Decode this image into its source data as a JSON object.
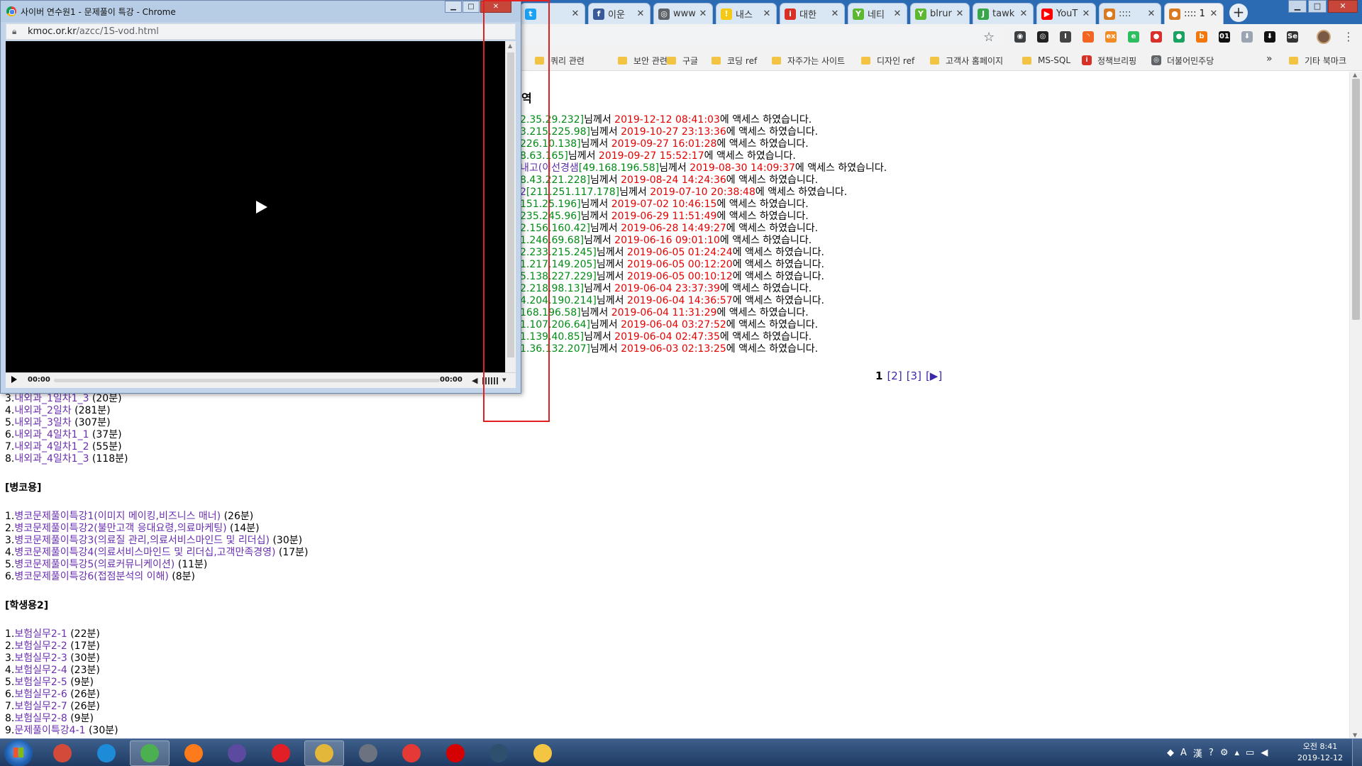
{
  "browser": {
    "tabs": [
      {
        "label": "",
        "color": "#1da1f2",
        "glyph": "t"
      },
      {
        "label": "이운",
        "color": "#3b5998",
        "glyph": "f"
      },
      {
        "label": "www",
        "color": "#5f6368",
        "glyph": "◎"
      },
      {
        "label": "내스",
        "color": "#f6c915",
        "glyph": "!"
      },
      {
        "label": "대한",
        "color": "#d93025",
        "glyph": "i"
      },
      {
        "label": "네티",
        "color": "#5cb82f",
        "glyph": "Y"
      },
      {
        "label": "blrur",
        "color": "#5cb82f",
        "glyph": "Y"
      },
      {
        "label": "tawk",
        "color": "#3aa64b",
        "glyph": "J"
      },
      {
        "label": "YouT",
        "color": "#ff0000",
        "glyph": "▶"
      },
      {
        "label": "::::",
        "color": "#d87a22",
        "glyph": "●"
      },
      {
        "label": ":::: 1",
        "color": "#d87a22",
        "glyph": "●",
        "active": true
      }
    ],
    "tab_close": "✕",
    "new_tab": "+",
    "extensions": [
      {
        "name": "ext-1",
        "color": "#3c4043",
        "glyph": "◉"
      },
      {
        "name": "ext-2",
        "color": "#222222",
        "glyph": "◎"
      },
      {
        "name": "ext-3",
        "color": "#444444",
        "glyph": "I"
      },
      {
        "name": "rss-icon",
        "color": "#f26522",
        "glyph": "◝"
      },
      {
        "name": "ext-5",
        "color": "#f38b24",
        "glyph": "ex"
      },
      {
        "name": "evernote-icon",
        "color": "#2dbe60",
        "glyph": "e"
      },
      {
        "name": "ext-7",
        "color": "#d9302c",
        "glyph": "●"
      },
      {
        "name": "ext-8",
        "color": "#1aa260",
        "glyph": "●"
      },
      {
        "name": "ext-9",
        "color": "#f4770b",
        "glyph": "b"
      },
      {
        "name": "ext-10",
        "color": "#111111",
        "glyph": "01"
      },
      {
        "name": "download-arrow-icon",
        "color": "#9aa4b2",
        "glyph": "⬇"
      },
      {
        "name": "download-icon",
        "color": "#111111",
        "glyph": "⬇"
      },
      {
        "name": "ext-13",
        "color": "#333333",
        "glyph": "Se"
      }
    ],
    "bookmarks": [
      {
        "label": "쿼리 관련",
        "type": "folder"
      },
      {
        "label": "보안 관련",
        "type": "folder"
      },
      {
        "label": "구글",
        "type": "folder"
      },
      {
        "label": "코딩 ref",
        "type": "folder"
      },
      {
        "label": "자주가는 사이트",
        "type": "folder"
      },
      {
        "label": "디자인 ref",
        "type": "folder"
      },
      {
        "label": "고객사 홈페이지",
        "type": "folder"
      },
      {
        "label": "MS-SQL",
        "type": "folder"
      },
      {
        "label": "정책브리핑",
        "type": "site",
        "color": "#d93025",
        "glyph": "i"
      },
      {
        "label": "더불어민주당",
        "type": "site",
        "color": "#5f6368",
        "glyph": "◎"
      }
    ],
    "bookmarks_more": "»",
    "other_bookmarks": "기타 북마크"
  },
  "popup": {
    "title": "사이버 연수원1 - 문제풀이 특강 - Chrome",
    "url_host": "kmoc.or.kr",
    "url_path": "/azcc/1S-vod.html",
    "player": {
      "current_time": "00:00",
      "duration": "00:00"
    }
  },
  "page": {
    "history_title": "역",
    "history": [
      {
        "pre": "",
        "ip": "2.35.29.232]",
        "mid": "님께서 ",
        "ts": "2019-12-12 08:41:03",
        "sfx": "에 액세스 하였습니다."
      },
      {
        "pre": "",
        "ip": "3.215.225.98]",
        "mid": "님께서 ",
        "ts": "2019-10-27 23:13:36",
        "sfx": "에 액세스 하였습니다."
      },
      {
        "pre": "",
        "ip": "226.10.138]",
        "mid": "님께서 ",
        "ts": "2019-09-27 16:01:28",
        "sfx": "에 액세스 하였습니다."
      },
      {
        "pre": "",
        "ip": "8.63.165]",
        "mid": "님께서 ",
        "ts": "2019-09-27 15:52:17",
        "sfx": "에 액세스 하였습니다."
      },
      {
        "pre": "내고(이선경샘",
        "ip": "[49.168.196.58]",
        "mid": "님께서 ",
        "ts": "2019-08-30 14:09:37",
        "sfx": "에 액세스 하였습니다."
      },
      {
        "pre": "",
        "ip": "8.43.221.228]",
        "mid": "님께서 ",
        "ts": "2019-08-24 14:24:36",
        "sfx": "에 액세스 하였습니다."
      },
      {
        "pre": "2",
        "ip": "[211.251.117.178]",
        "mid": "님께서 ",
        "ts": "2019-07-10 20:38:48",
        "sfx": "에 액세스 하였습니다."
      },
      {
        "pre": "",
        "ip": "151.25.196]",
        "mid": "님께서 ",
        "ts": "2019-07-02 10:46:15",
        "sfx": "에 액세스 하였습니다."
      },
      {
        "pre": "",
        "ip": "235.245.96]",
        "mid": "님께서 ",
        "ts": "2019-06-29 11:51:49",
        "sfx": "에 액세스 하였습니다."
      },
      {
        "pre": "",
        "ip": "2.156.160.42]",
        "mid": "님께서 ",
        "ts": "2019-06-28 14:49:27",
        "sfx": "에 액세스 하였습니다."
      },
      {
        "pre": "",
        "ip": "1.246.69.68]",
        "mid": "님께서 ",
        "ts": "2019-06-16 09:01:10",
        "sfx": "에 액세스 하였습니다."
      },
      {
        "pre": "",
        "ip": "2.233.215.245]",
        "mid": "님께서 ",
        "ts": "2019-06-05 01:24:24",
        "sfx": "에 액세스 하였습니다."
      },
      {
        "pre": "",
        "ip": "1.217.149.205]",
        "mid": "님께서 ",
        "ts": "2019-06-05 00:12:20",
        "sfx": "에 액세스 하였습니다."
      },
      {
        "pre": "",
        "ip": "5.138.227.229]",
        "mid": "님께서 ",
        "ts": "2019-06-05 00:10:12",
        "sfx": "에 액세스 하였습니다."
      },
      {
        "pre": "",
        "ip": "2.218.98.13]",
        "mid": "님께서 ",
        "ts": "2019-06-04 23:37:39",
        "sfx": "에 액세스 하였습니다."
      },
      {
        "pre": "",
        "ip": "4.204.190.214]",
        "mid": "님께서 ",
        "ts": "2019-06-04 14:36:57",
        "sfx": "에 액세스 하였습니다."
      },
      {
        "pre": "",
        "ip": "168.196.58]",
        "mid": "님께서 ",
        "ts": "2019-06-04 11:31:29",
        "sfx": "에 액세스 하였습니다."
      },
      {
        "pre": "",
        "ip": "1.107.206.64]",
        "mid": "님께서 ",
        "ts": "2019-06-04 03:27:52",
        "sfx": "에 액세스 하였습니다."
      },
      {
        "pre": "",
        "ip": "1.139.40.85]",
        "mid": "님께서 ",
        "ts": "2019-06-04 02:47:35",
        "sfx": "에 액세스 하였습니다."
      },
      {
        "pre": "",
        "ip": "1.36.132.207]",
        "mid": "님께서 ",
        "ts": "2019-06-03 02:13:25",
        "sfx": "에 액세스 하였습니다."
      }
    ],
    "pager": {
      "current": "1",
      "pages": [
        "[2]",
        "[3]"
      ],
      "next": "[▶]"
    },
    "sections": [
      {
        "title": "",
        "items": [
          {
            "num": "3.",
            "title": "내외과_1일차1_3",
            "dur": " (20분)"
          },
          {
            "num": "4.",
            "title": "내외과_2일차",
            "dur": " (281분)"
          },
          {
            "num": "5.",
            "title": "내외과_3일차",
            "dur": " (307분)"
          },
          {
            "num": "6.",
            "title": "내외과_4일차1_1",
            "dur": " (37분)"
          },
          {
            "num": "7.",
            "title": "내외과_4일차1_2",
            "dur": " (55분)"
          },
          {
            "num": "8.",
            "title": "내외과_4일차1_3",
            "dur": " (118분)"
          }
        ]
      },
      {
        "title": "[병코용]",
        "items": [
          {
            "num": "1.",
            "title": "병코문제풀이특강1(이미지 메이킹,비즈니스 매너)",
            "dur": " (26분)"
          },
          {
            "num": "2.",
            "title": "병코문제풀이특강2(불만고객 응대요령,의료마케팅)",
            "dur": " (14분)"
          },
          {
            "num": "3.",
            "title": "병코문제풀이특강3(의료질 관리,의료서비스마인드 및 리더십)",
            "dur": " (30분)"
          },
          {
            "num": "4.",
            "title": "병코문제풀이특강4(의료서비스마인드 및 리더십,고객만족경영)",
            "dur": " (17분)"
          },
          {
            "num": "5.",
            "title": "병코문제풀이특강5(의료커뮤니케이션)",
            "dur": " (11분)"
          },
          {
            "num": "6.",
            "title": "병코문제풀이특강6(접점분석의 이해)",
            "dur": " (8분)"
          }
        ]
      },
      {
        "title": "[학생용2]",
        "items": [
          {
            "num": "1.",
            "title": "보험실무2-1",
            "dur": " (22분)"
          },
          {
            "num": "2.",
            "title": "보험실무2-2",
            "dur": " (17분)"
          },
          {
            "num": "3.",
            "title": "보험실무2-3",
            "dur": " (30분)"
          },
          {
            "num": "4.",
            "title": "보험실무2-4",
            "dur": " (23분)"
          },
          {
            "num": "5.",
            "title": "보험실무2-5",
            "dur": " (9분)"
          },
          {
            "num": "6.",
            "title": "보험실무2-6",
            "dur": " (26분)"
          },
          {
            "num": "7.",
            "title": "보험실무2-7",
            "dur": " (26분)"
          },
          {
            "num": "8.",
            "title": "보험실무2-8",
            "dur": " (9분)"
          },
          {
            "num": "9.",
            "title": "문제풀이특강4-1",
            "dur": " (30분)"
          }
        ]
      }
    ]
  },
  "taskbar": {
    "apps": [
      {
        "name": "taskbar-app-vivaldi",
        "color": "#d44a3a",
        "sel": false
      },
      {
        "name": "taskbar-app-ie",
        "color": "#1e8bd8",
        "sel": false
      },
      {
        "name": "taskbar-app-chrome",
        "color": "#4caf50",
        "sel": true
      },
      {
        "name": "taskbar-app-firefox",
        "color": "#ff7a1a",
        "sel": false
      },
      {
        "name": "taskbar-app-eclipse",
        "color": "#5b4aa0",
        "sel": false
      },
      {
        "name": "taskbar-app-opera",
        "color": "#e21f26",
        "sel": false
      },
      {
        "name": "taskbar-app-tool",
        "color": "#e3b73a",
        "sel": true
      },
      {
        "name": "taskbar-app-book",
        "color": "#6b7280",
        "sel": false
      },
      {
        "name": "taskbar-app-pokeball",
        "color": "#e53935",
        "sel": false
      },
      {
        "name": "taskbar-app-record",
        "color": "#d50000",
        "sel": false
      },
      {
        "name": "taskbar-app-tree",
        "color": "#2f4f6f",
        "sel": false
      },
      {
        "name": "taskbar-app-folder",
        "color": "#f4c542",
        "sel": false
      }
    ],
    "tray_lang": "A",
    "tray_hanja": "漢",
    "clock_time": "오전 8:41",
    "clock_date": "2019-12-12"
  }
}
